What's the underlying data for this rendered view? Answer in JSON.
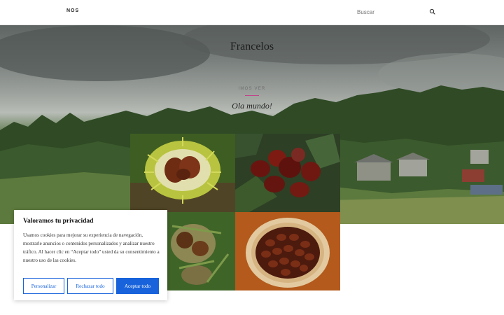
{
  "header": {
    "nav": [
      "NOS"
    ],
    "search": {
      "placeholder": "Buscar",
      "icon": "search-icon"
    }
  },
  "hero": {
    "site_title": "Francelos",
    "post": {
      "category": "IMOS VER",
      "title": "Ola mundo!"
    }
  },
  "gallery": {
    "images": [
      {
        "subject": "chestnut-burr-open"
      },
      {
        "subject": "chestnuts-on-leaves"
      },
      {
        "subject": "chestnut-burrs-on-ground"
      },
      {
        "subject": "chestnuts-in-basket"
      }
    ]
  },
  "cookie_banner": {
    "title": "Valoramos tu privacidad",
    "body": "Usamos cookies para mejorar su experiencia de navegación, mostrarle anuncios o contenidos personalizados y analizar nuestro tráfico. Al hacer clic en “Aceptar todo” usted da su consentimiento a nuestro uso de las cookies.",
    "buttons": {
      "customize": "Personalizar",
      "reject": "Rechazar todo",
      "accept": "Aceptar todo"
    }
  },
  "colors": {
    "accent": "#1863dc",
    "divider": "#c0448a"
  }
}
